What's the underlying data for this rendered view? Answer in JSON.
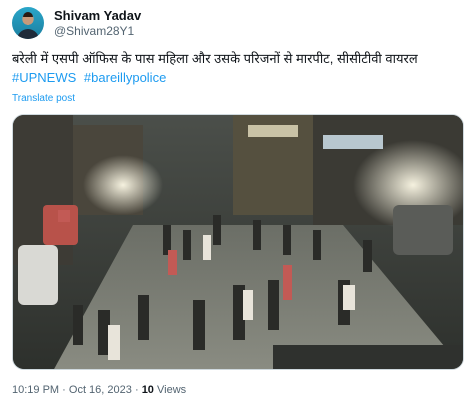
{
  "author": {
    "display_name": "Shivam Yadav",
    "handle": "@Shivam28Y1",
    "avatar": "profile-photo"
  },
  "tweet": {
    "text": "बरेली में एसपी ऑफिस के पास महिला और उसके परिजनों से मारपीट, सीसीटीवी वायरल",
    "hashtags": [
      "#UPNEWS",
      "#bareillypolice"
    ],
    "translate_label": "Translate post"
  },
  "media": {
    "type": "cctv-video-still",
    "description_icon": "video-frame"
  },
  "meta": {
    "time": "10:19 PM",
    "separator1": "·",
    "date": "Oct 16, 2023",
    "separator2": "·",
    "views_count": "10",
    "views_label": "Views"
  },
  "colors": {
    "link": "#1d9bf0",
    "text": "#0f1419",
    "secondary": "#536471"
  }
}
